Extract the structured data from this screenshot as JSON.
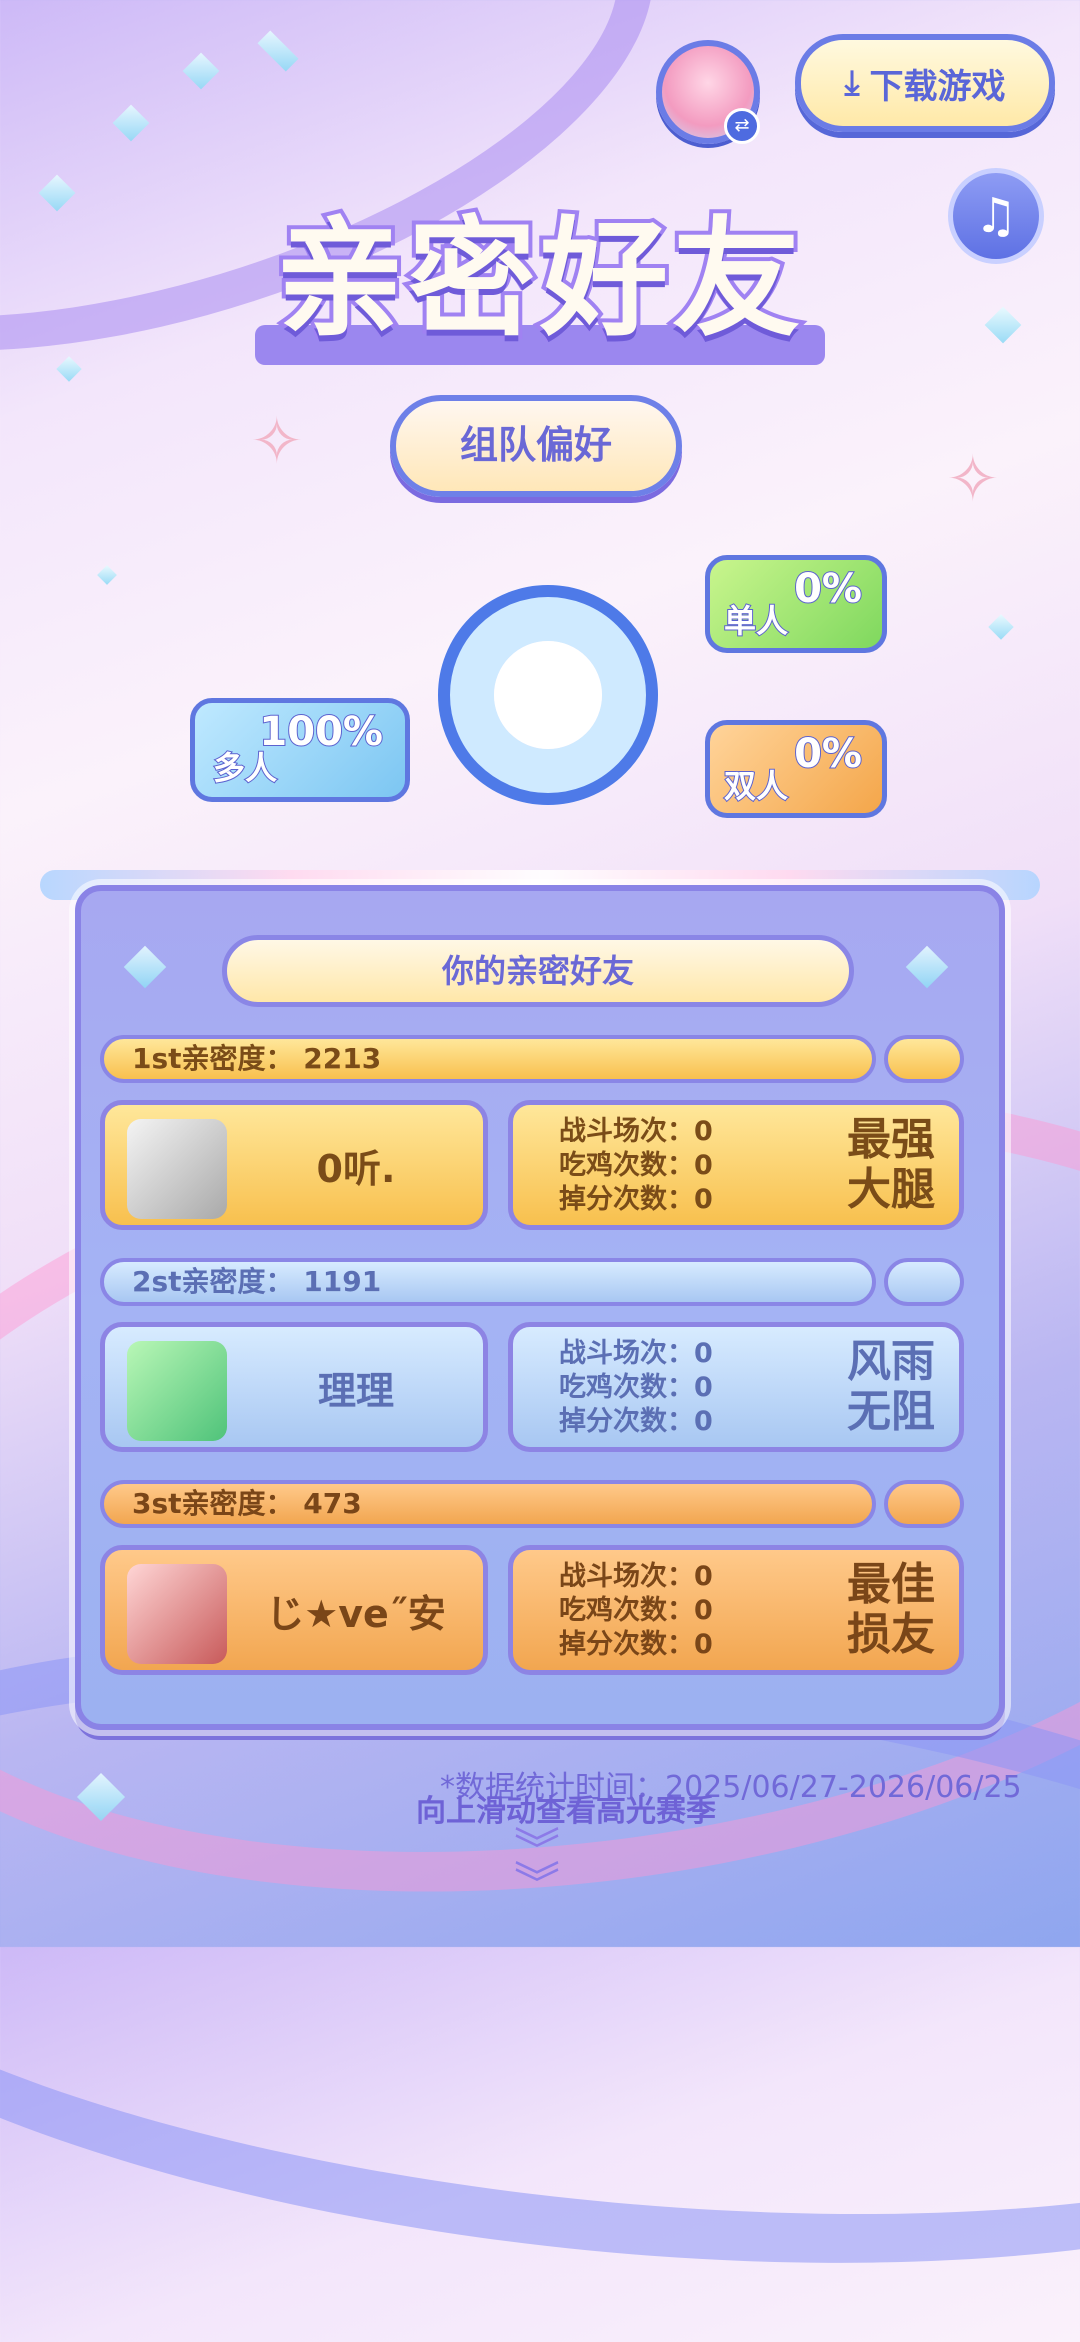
{
  "header": {
    "download_label": "下载游戏",
    "download_icon": "download-icon",
    "music_icon": "music-note-icon",
    "switch_icon": "switch-icon"
  },
  "title": "亲密好友",
  "team_preference": {
    "button_label": "组队偏好",
    "single": {
      "label": "单人",
      "percent": "0%"
    },
    "double": {
      "label": "双人",
      "percent": "0%"
    },
    "multi": {
      "label": "多人",
      "percent": "100%"
    }
  },
  "panel": {
    "heading": "你的亲密好友",
    "friends": [
      {
        "rank_label": "1st亲密度：",
        "intimacy": "2213",
        "name": "0听.",
        "stats": [
          {
            "label": "战斗场次：",
            "value": "0"
          },
          {
            "label": "吃鸡次数：",
            "value": "0"
          },
          {
            "label": "掉分次数：",
            "value": "0"
          }
        ],
        "badge_line1": "最强",
        "badge_line2": "大腿"
      },
      {
        "rank_label": "2st亲密度：",
        "intimacy": "1191",
        "name": "理理",
        "stats": [
          {
            "label": "战斗场次：",
            "value": "0"
          },
          {
            "label": "吃鸡次数：",
            "value": "0"
          },
          {
            "label": "掉分次数：",
            "value": "0"
          }
        ],
        "badge_line1": "风雨",
        "badge_line2": "无阻"
      },
      {
        "rank_label": "3st亲密度：",
        "intimacy": "473",
        "name": "じ★ve˝安",
        "stats": [
          {
            "label": "战斗场次：",
            "value": "0"
          },
          {
            "label": "吃鸡次数：",
            "value": "0"
          },
          {
            "label": "掉分次数：",
            "value": "0"
          }
        ],
        "badge_line1": "最佳",
        "badge_line2": "损友"
      }
    ]
  },
  "footer": {
    "note": "*数据统计时间：2025/06/27-2026/06/25",
    "swipe_hint": "向上滑动查看高光赛季"
  },
  "colors": {
    "accent": "#6b7ce6",
    "gold": "#f8c04e",
    "blue": "#a8c7f2",
    "orange": "#f2a650",
    "donut": "#4e7ae8"
  }
}
